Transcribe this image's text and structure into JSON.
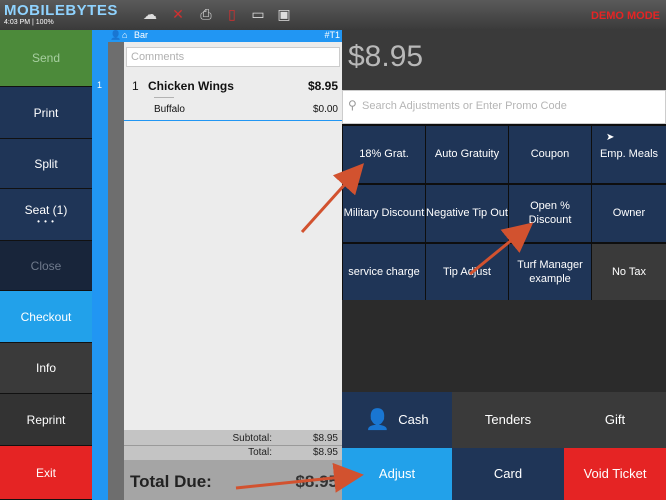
{
  "header": {
    "brand": "MOBILEBYTES",
    "status_line": "4:03 PM | 100%",
    "mode": "DEMO MODE",
    "icons": [
      "cloud-icon",
      "wifi-off-icon",
      "printer-icon",
      "card-reader-icon",
      "chat-icon",
      "monitor-icon"
    ]
  },
  "sidebar": {
    "send": "Send",
    "print": "Print",
    "split": "Split",
    "seat": "Seat (1)",
    "seat_dots": "• • •",
    "close": "Close",
    "checkout": "Checkout",
    "info": "Info",
    "reprint": "Reprint",
    "exit": "Exit"
  },
  "order": {
    "location": "Bar",
    "table": "#T1",
    "seat_number": "1",
    "comments_placeholder": "Comments",
    "item": {
      "qty": "1",
      "name": "Chicken Wings",
      "price": "$8.95"
    },
    "modifier": {
      "dashes": "----------",
      "name": "Buffalo",
      "price": "$0.00"
    },
    "subtotal_label": "Subtotal:",
    "subtotal_value": "$8.95",
    "total_label": "Total:",
    "total_value": "$8.95",
    "total_due_label": "Total Due:",
    "total_due_value": "$8.95"
  },
  "payment": {
    "amount": "$8.95",
    "search_placeholder": "Search Adjustments or Enter Promo Code",
    "adjustments": [
      "18% Grat.",
      "Auto Gratuity",
      "Coupon",
      "Emp. Meals",
      "Military Discount",
      "Negative Tip Out",
      "Open % Discount",
      "Owner",
      "service charge",
      "Tip Adjust",
      "Turf Manager example",
      "No Tax"
    ],
    "cash": "Cash",
    "tenders": "Tenders",
    "gift": "Gift",
    "adjust": "Adjust",
    "card": "Card",
    "void_ticket": "Void Ticket"
  },
  "colors": {
    "accent_blue": "#2196f3",
    "navy_button": "#1f3557",
    "exit_red": "#e52424",
    "send_green": "#4c8a3a",
    "annotation_arrow": "#d2522f"
  }
}
